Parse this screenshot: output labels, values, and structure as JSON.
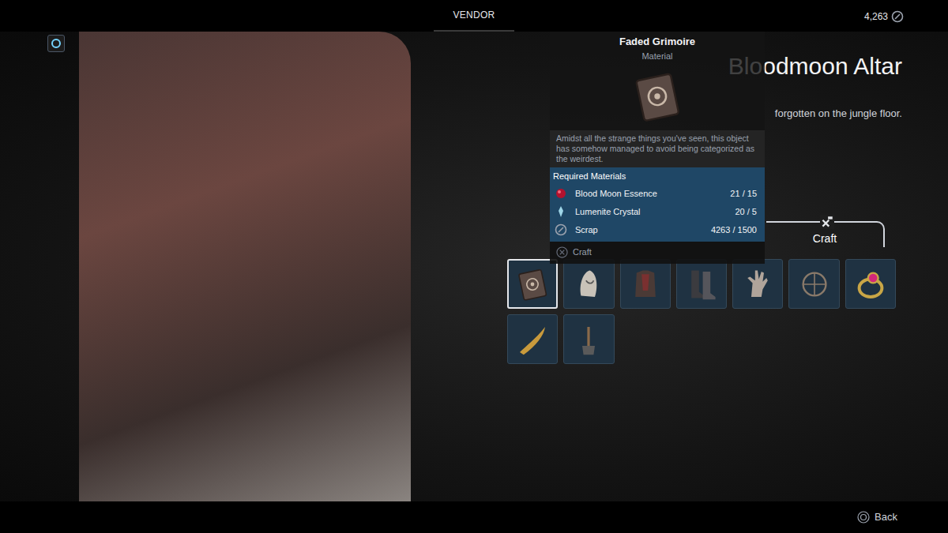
{
  "top_bar": {
    "title": "VENDOR",
    "currency": "4,263"
  },
  "item": {
    "title": "Bloodmoon Altar",
    "description": "forgotten on the jungle floor."
  },
  "tooltip": {
    "name": "Faded Grimoire",
    "type": "Material",
    "description": "Amidst all the strange things you've seen, this object has somehow managed to avoid being categorized as the weirdest.",
    "materials_heading": "Required Materials",
    "materials": [
      {
        "name": "Blood Moon Essence",
        "amount": "21 / 15",
        "kind": "essence"
      },
      {
        "name": "Lumenite Crystal",
        "amount": "20 / 5",
        "kind": "crystal"
      },
      {
        "name": "Scrap",
        "amount": "4263 / 1500",
        "kind": "scrap"
      }
    ],
    "action": "Craft"
  },
  "tabs": [
    {
      "label": "Craft",
      "selected": true
    }
  ],
  "slots": [
    {
      "kind": "book",
      "selected": true
    },
    {
      "kind": "helmet",
      "selected": false
    },
    {
      "kind": "armor",
      "selected": false
    },
    {
      "kind": "boots",
      "selected": false
    },
    {
      "kind": "gloves",
      "selected": false
    },
    {
      "kind": "amulet",
      "selected": false
    },
    {
      "kind": "ring",
      "selected": false
    },
    {
      "kind": "blade",
      "selected": false
    },
    {
      "kind": "hammer",
      "selected": false
    }
  ],
  "footer": {
    "back": "Back"
  }
}
